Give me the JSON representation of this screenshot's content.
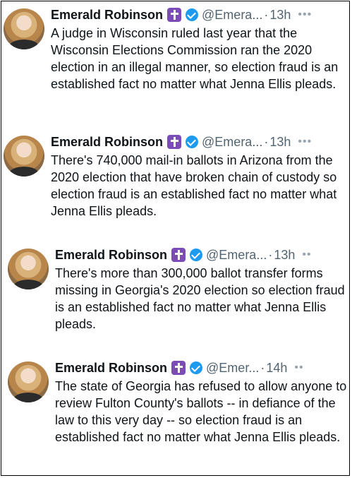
{
  "tweets": [
    {
      "name": "Emerald Robinson",
      "handle": "@Emera...",
      "time": "13h",
      "text": "A judge in Wisconsin ruled last year that the Wisconsin Elections Commission ran the 2020 election in an illegal manner, so election fraud is an established fact no matter what Jenna Ellis pleads."
    },
    {
      "name": "Emerald Robinson",
      "handle": "@Emera...",
      "time": "13h",
      "text": "There's 740,000 mail-in ballots in Arizona from the 2020 election that have broken chain of custody so election fraud is an established fact no matter what Jenna Ellis pleads."
    },
    {
      "name": "Emerald Robinson",
      "handle": "@Emera...",
      "time": "13h",
      "text": "There's more than 300,000 ballot transfer forms missing in Georgia's 2020 election so election fraud is an established fact no matter what Jenna Ellis pleads."
    },
    {
      "name": "Emerald Robinson",
      "handle": "@Emer...",
      "time": "14h",
      "text": "The state of Georgia has refused to allow anyone to review Fulton County's ballots -- in defiance of the law to this very day -- so election fraud is an established fact no matter what Jenna Ellis pleads."
    }
  ],
  "icons": {
    "badge": "latin-cross-icon",
    "verified": "verified-check-icon",
    "more": "more-options-icon"
  }
}
